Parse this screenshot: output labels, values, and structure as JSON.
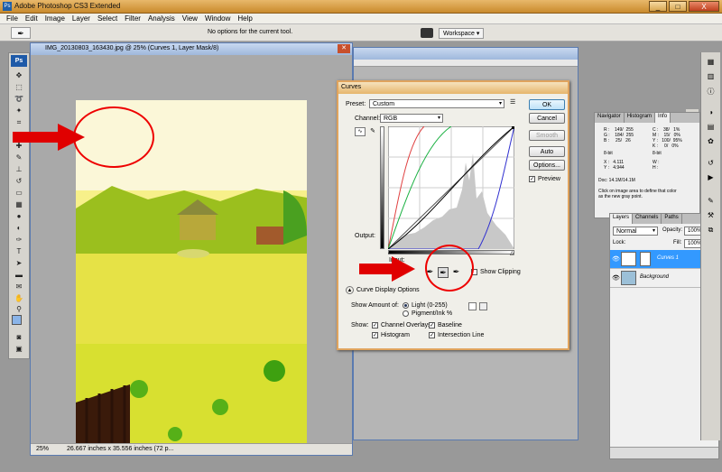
{
  "app": {
    "title": "Adobe Photoshop CS3 Extended",
    "icon": "photoshop-icon"
  },
  "window_buttons": [
    "_",
    "□",
    "X"
  ],
  "menu": [
    "File",
    "Edit",
    "Image",
    "Layer",
    "Select",
    "Filter",
    "Analysis",
    "View",
    "Window",
    "Help"
  ],
  "options_bar": {
    "hint": "No options for the current tool.",
    "workspace": "Workspace ▾"
  },
  "document": {
    "title": "IMG_20130803_163430.jpg @ 25% (Curves 1, Layer Mask/8)",
    "zoom": "25%",
    "dims": "26.667 inches x 35.556 inches (72 p..."
  },
  "curves": {
    "title": "Curves",
    "preset_label": "Preset:",
    "preset_value": "Custom",
    "channel_label": "Channel:",
    "channel_value": "RGB",
    "output_label": "Output:",
    "input_label": "Input:",
    "show_clipping": "Show Clipping",
    "display_options": "Curve Display Options",
    "show_amount_label": "Show Amount of:",
    "light": "Light  (0-255)",
    "pigment": "Pigment/Ink %",
    "show_label": "Show:",
    "channel_overlays": "Channel Overlays",
    "baseline": "Baseline",
    "histogram": "Histogram",
    "intersection": "Intersection Line",
    "buttons": {
      "ok": "OK",
      "cancel": "Cancel",
      "smooth": "Smooth",
      "auto": "Auto",
      "options": "Options..."
    },
    "preview": "Preview"
  },
  "info_panel": {
    "tabs": [
      "Navigator",
      "Histogram",
      "Info"
    ],
    "rgb": "R :    149/  255\nG :    184/  255\nB :     25/   26",
    "cmyk": "C :    38/   1%\nM :    15/   0%\nY :   100/  95%\nK :     0/   0%",
    "bits_left": "8-bit",
    "bits_right": "8-bit",
    "xy": "X :   4.111\nY :   4.944",
    "wh": "W :\nH :",
    "doc": "Doc: 14.1M/14.1M",
    "help": "Click on image area to define that color\nas the new gray point."
  },
  "layers_panel": {
    "tabs": [
      "Layers",
      "Channels",
      "Paths"
    ],
    "blend": "Normal",
    "opacity_label": "Opacity:",
    "opacity": "100%",
    "lock_label": "Lock:",
    "fill_label": "Fill:",
    "fill": "100%",
    "layers": [
      {
        "name": "Curves 1",
        "selected": true
      },
      {
        "name": "Background",
        "selected": false
      }
    ]
  },
  "accent": "#e00000"
}
